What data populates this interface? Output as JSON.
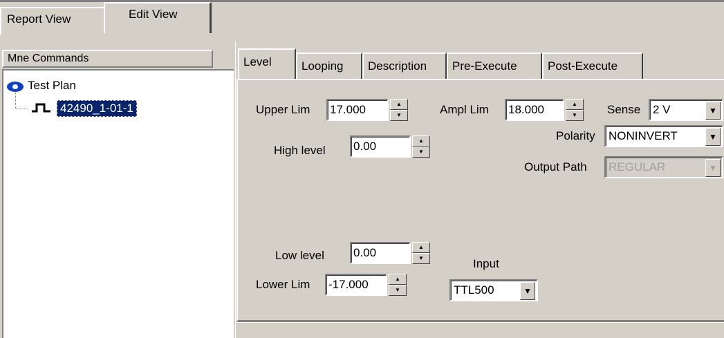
{
  "top_tabs": [
    {
      "label": "Report View",
      "active": false
    },
    {
      "label": "Edit View",
      "active": true
    }
  ],
  "left_panel": {
    "header": "Mne Commands",
    "tree": {
      "root": {
        "label": "Test Plan",
        "icon": "eye-icon"
      },
      "child": {
        "label": "42490_1-01-1",
        "icon": "pulse-icon",
        "selected": true
      }
    }
  },
  "inner_tabs": [
    {
      "label": "Level",
      "active": true
    },
    {
      "label": "Looping",
      "active": false
    },
    {
      "label": "Description",
      "active": false
    },
    {
      "label": "Pre-Execute",
      "active": false
    },
    {
      "label": "Post-Execute",
      "active": false
    }
  ],
  "form": {
    "upper_lim": {
      "label": "Upper Lim",
      "value": "17.000"
    },
    "ampl_lim": {
      "label": "Ampl Lim",
      "value": "18.000"
    },
    "sense": {
      "label": "Sense",
      "value": "2 V"
    },
    "polarity": {
      "label": "Polarity",
      "value": "NONINVERT"
    },
    "output_path": {
      "label": "Output Path",
      "value": "REGULAR",
      "disabled": true
    },
    "high_level": {
      "label": "High level",
      "value": "0.00"
    },
    "low_level": {
      "label": "Low level",
      "value": "0.00"
    },
    "lower_lim": {
      "label": "Lower Lim",
      "value": "-17.000"
    },
    "input": {
      "label": "Input",
      "value": "TTL500"
    }
  },
  "colors": {
    "face": "#d4d0c8",
    "selection": "#0a246a",
    "icon_blue": "#1040c0"
  }
}
